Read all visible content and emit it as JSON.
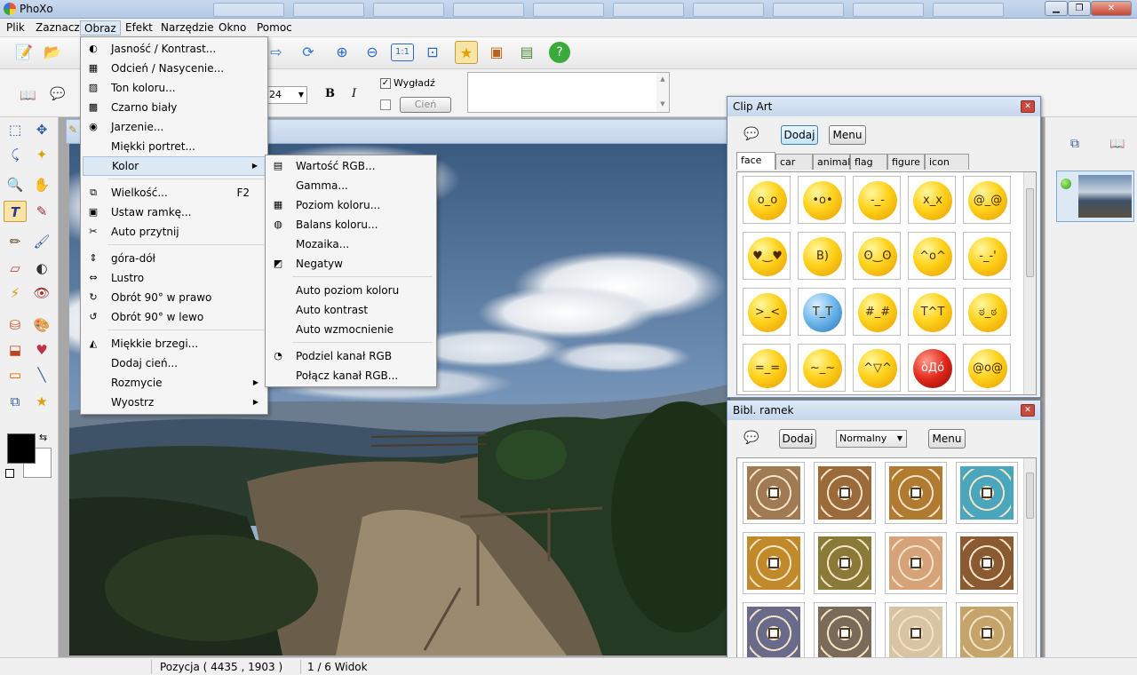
{
  "app": {
    "title": "PhoXo"
  },
  "menubar": {
    "items": [
      "Plik",
      "Zaznacz",
      "Obraz",
      "Efekt",
      "Narzędzie",
      "Okno",
      "Pomoc"
    ]
  },
  "toolbar2": {
    "font_size": "24",
    "bold": "B",
    "italic": "I",
    "wyglad_label": "Wygładź",
    "cien_label": "Cień"
  },
  "obraz_menu": [
    {
      "label": "Jasność / Kontrast...",
      "icon": "contrast-icon"
    },
    {
      "label": "Odcień / Nasycenie...",
      "icon": "hue-icon"
    },
    {
      "label": "Ton koloru...",
      "icon": "tone-icon"
    },
    {
      "label": "Czarno biały",
      "icon": "bw-icon"
    },
    {
      "label": "Jarzenie...",
      "icon": "glow-icon"
    },
    {
      "label": "Miękki portret...",
      "icon": ""
    },
    {
      "label": "Kolor",
      "icon": "",
      "submenu": true
    },
    {
      "label": "Wielkość...",
      "icon": "resize-icon",
      "shortcut": "F2"
    },
    {
      "label": "Ustaw ramkę...",
      "icon": "frame-icon"
    },
    {
      "label": "Auto przytnij",
      "icon": "scissors-icon"
    },
    {
      "label": "góra-dół",
      "icon": "flip-vertical-icon"
    },
    {
      "label": "Lustro",
      "icon": "mirror-icon"
    },
    {
      "label": "Obrót 90° w prawo",
      "icon": "rotate-right-icon"
    },
    {
      "label": "Obrót 90° w lewo",
      "icon": "rotate-left-icon"
    },
    {
      "label": "Miękkie brzegi...",
      "icon": "soft-edge-icon"
    },
    {
      "label": "Dodaj cień...",
      "icon": ""
    },
    {
      "label": "Rozmycie",
      "icon": "",
      "submenu": true
    },
    {
      "label": "Wyostrz",
      "icon": "",
      "submenu": true
    }
  ],
  "kolor_menu": [
    {
      "label": "Wartość RGB...",
      "icon": "rgb-icon"
    },
    {
      "label": "Gamma...",
      "icon": ""
    },
    {
      "label": "Poziom koloru...",
      "icon": "level-icon"
    },
    {
      "label": "Balans koloru...",
      "icon": "balance-icon"
    },
    {
      "label": "Mozaika...",
      "icon": ""
    },
    {
      "label": "Negatyw",
      "icon": "negative-icon"
    },
    {
      "label": "Auto poziom koloru",
      "icon": ""
    },
    {
      "label": "Auto kontrast",
      "icon": ""
    },
    {
      "label": "Auto wzmocnienie",
      "icon": ""
    },
    {
      "label": "Podziel kanał RGB",
      "icon": "split-channel-icon"
    },
    {
      "label": "Połącz kanał RGB...",
      "icon": ""
    }
  ],
  "clipart": {
    "title": "Clip Art",
    "add_label": "Dodaj",
    "menu_label": "Menu",
    "tabs": [
      "face",
      "car",
      "animal",
      "flag",
      "figure",
      "icon"
    ],
    "faces": [
      "o_o",
      "•o•",
      "-_-",
      "x_x",
      "@_@",
      "♥‿♥",
      "B)",
      "ʘ‿ʘ",
      "^o^",
      "-_-'",
      ">_<",
      "T_T",
      "#_#",
      "T^T",
      "ಠ_ಠ",
      "=_=",
      "~_~",
      "^▽^",
      "òДó",
      "@o@"
    ]
  },
  "frames": {
    "title": "Bibl. ramek",
    "add_label": "Dodaj",
    "mode_label": "Normalny",
    "menu_label": "Menu",
    "colors": [
      "#a07a52",
      "#9a6a3a",
      "#b07a30",
      "#4aa6bc",
      "#c08a2a",
      "#8a7a3a",
      "#d6a27a",
      "#8a5a32",
      "#6a6a8a",
      "#7a6a5a",
      "#d8c4a4",
      "#c4a46a"
    ]
  },
  "status": {
    "position": "Pozycja ( 4435 , 1903 )",
    "view": "1 / 6 Widok"
  },
  "colors": {
    "menu_highlight": "#dde8f5",
    "panel_border": "#6d8cb3"
  }
}
